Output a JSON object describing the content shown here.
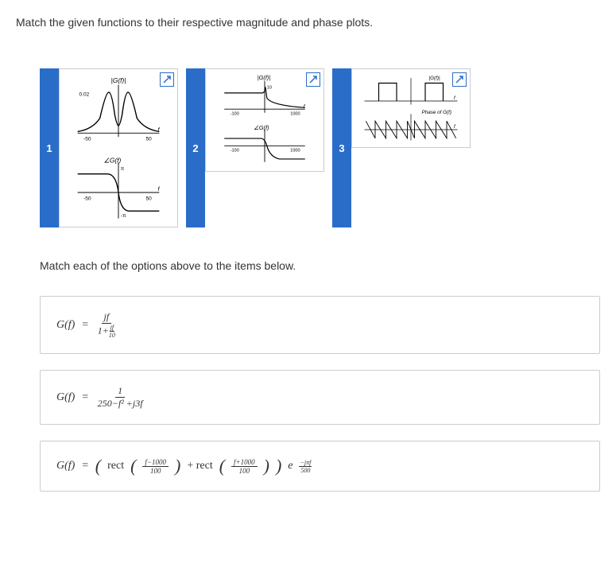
{
  "question": "Match the given functions to their respective magnitude and phase plots.",
  "instruction": "Match each of the options above to the items below.",
  "options": [
    {
      "number": "1",
      "mag_label": "|G(f)|",
      "phase_label": "∠G(f)",
      "mag_yval": "0.02",
      "xtick_neg": "-50",
      "xtick_pos": "50",
      "xvar": "f",
      "phase_top": "π",
      "phase_bot": "-π"
    },
    {
      "number": "2",
      "mag_label": "|G(f)|",
      "phase_label": "∠G(f)",
      "mag_yval": "10",
      "xtick_neg": "-100",
      "xtick_pos": "1000",
      "xvar": "f"
    },
    {
      "number": "3",
      "mag_label": "|G(f)|",
      "phase_label": "Phase of G(f)",
      "xtick_pos": "f",
      "xvar": "f"
    }
  ],
  "answers": [
    {
      "lhs": "G(f)",
      "eq": "=",
      "frac_num": "jf",
      "frac_den_left": "1+",
      "frac_den_sub_num": "jf",
      "frac_den_sub_den": "10"
    },
    {
      "lhs": "G(f)",
      "eq": "=",
      "frac_num": "1",
      "frac_den": "250−f² +j3f"
    },
    {
      "lhs": "G(f)",
      "eq": "=",
      "rect1": "rect",
      "arg1_num": "f−1000",
      "arg1_den": "100",
      "plus": "+ rect",
      "arg2_num": "f+1000",
      "arg2_den": "100",
      "exp_e": "e",
      "exp_num": "−jπf",
      "exp_den": "500"
    }
  ],
  "icons": {
    "expand": "expand"
  }
}
